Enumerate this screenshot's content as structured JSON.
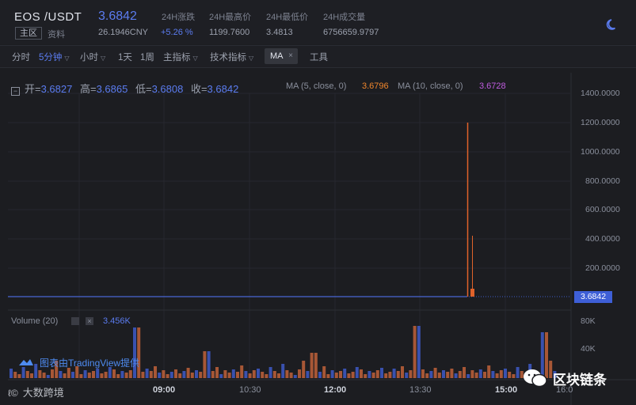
{
  "header": {
    "pair": "EOS /USDT",
    "price": "3.6842",
    "stats": [
      {
        "label": "24H涨跌",
        "value": "26.1946CNY",
        "value2": "+5.26 %"
      },
      {
        "label": "24H最高价",
        "value": "1199.7600"
      },
      {
        "label": "24H最低价",
        "value": "3.4813"
      },
      {
        "label": "24H成交量",
        "value": "6756659.9797"
      }
    ],
    "tab_main": "主区",
    "tab_info": "资料",
    "theme_icon": "moon-icon"
  },
  "toolbar": {
    "items": [
      "分时",
      "5分钟",
      "小时",
      "1天",
      "1周",
      "主指标",
      "技术指标",
      "工具"
    ],
    "active": "5分钟",
    "ma_chip": "MA",
    "ma_close": "×"
  },
  "ohlc": {
    "open_label": "开=",
    "open": "3.6827",
    "high_label": "高=",
    "high": "3.6865",
    "low_label": "低=",
    "low": "3.6808",
    "close_label": "收=",
    "close": "3.6842"
  },
  "ma_legend": {
    "ma5_label": "MA (5, close, 0)",
    "ma5_value": "3.6796",
    "ma5_color": "#f0862c",
    "ma10_label": "MA (10, close, 0)",
    "ma10_value": "3.6728",
    "ma10_color": "#c05ce0"
  },
  "price_axis": [
    "1400.0000",
    "1200.0000",
    "1000.0000",
    "800.0000",
    "600.0000",
    "400.0000",
    "200.0000"
  ],
  "current_price_tag": "3.6842",
  "volume": {
    "label": "Volume (20)",
    "value": "3.456K",
    "axis": [
      "80K",
      "40K"
    ]
  },
  "time_axis": [
    "09:00",
    "10:30",
    "12:00",
    "13:30",
    "15:00",
    "16:0"
  ],
  "tradingview": "图表由TradingView提供",
  "watermark_left": "大数跨境",
  "watermark_right": "区块链条",
  "colors": {
    "up": "#3e5bc8",
    "down": "#c0623a",
    "accent": "#5b7cf0",
    "bg": "#1c1d21"
  },
  "chart_data": {
    "type": "bar",
    "title": "",
    "series": [
      {
        "values": [
          3.6842,
          1199.76,
          420,
          3.6842
        ]
      }
    ],
    "price_spike_high": 1199.76,
    "secondary_spike_high": 420,
    "baseline_price": 3.6842,
    "ylim": [
      0,
      1400
    ],
    "volume_ylim": [
      0,
      100000
    ]
  }
}
